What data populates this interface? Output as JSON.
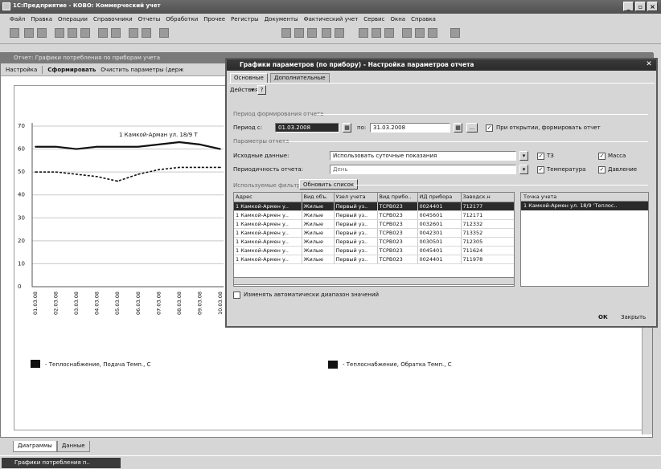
{
  "app": {
    "title": "1С:Предприятие - КОВО: Коммерческий учет",
    "window_controls": [
      "_",
      "▫",
      "×"
    ]
  },
  "menu": [
    "Файл",
    "Правка",
    "Операции",
    "Справочники",
    "Отчеты",
    "Обработки",
    "Прочее",
    "Регистры",
    "Документы",
    "Фактический учет",
    "Сервис",
    "Окна",
    "Справка"
  ],
  "report": {
    "title": "Отчет: Графики потребления по приборам учета",
    "toolbar": {
      "settings": "Настройка",
      "generate": "Сформировать",
      "clear": "Очистить параметры (держ"
    },
    "tabs": [
      "Диаграммы",
      "Данные"
    ]
  },
  "chart_data": {
    "type": "line",
    "ylim": [
      0,
      70
    ],
    "yticks": [
      "70",
      "60",
      "50",
      "40",
      "30",
      "20",
      "10",
      "0"
    ],
    "categories": [
      "01.03.08",
      "02.03.08",
      "03.03.08",
      "04.03.08",
      "05.03.08",
      "06.03.08",
      "07.03.08",
      "08.03.08",
      "09.03.08",
      "10.03.08"
    ],
    "annotation": "1 Камкой-Арман ул. 18/9 Т",
    "series": [
      {
        "name": "- Теплоснабжение, Подача Темп., С",
        "values": [
          61,
          61,
          60,
          61,
          61,
          61,
          62,
          63,
          62,
          60
        ],
        "style": "solid"
      },
      {
        "name": "- Теплоснабжение, Обратка Темп., С",
        "values": [
          50,
          50,
          49,
          48,
          46,
          49,
          51,
          52,
          52,
          52
        ],
        "style": "dashed"
      }
    ]
  },
  "dialog": {
    "title": "Графики параметров (по прибору) - Настройка параметров отчета",
    "tabs": [
      "Основные",
      "Дополнительные"
    ],
    "actions": "Действия",
    "help": "?",
    "period_group": "Период формирования отчета",
    "period_from_label": "Период с:",
    "period_from": "01.03.2008",
    "period_to_label": "по:",
    "period_to": "31.03.2008",
    "period_btn": "...",
    "auto_generate": "При открытии, формировать отчет",
    "params_group": "Параметры отчета",
    "source_label": "Исходные данные:",
    "source_value": "Использовать суточные показания",
    "periodicity_label": "Периодичность отчета:",
    "periodicity_value": "День",
    "filters_label": "Используемые фильтры",
    "refresh_btn": "Обновить список",
    "checks": {
      "t3": "ТЗ",
      "mass": "Масса",
      "temperature": "Температура",
      "pressure": "Давление"
    },
    "grid": {
      "columns": [
        "Адрес",
        "Вид объ.",
        "Узел учета",
        "Вид прибо..",
        "ИД прибора",
        "Заводск.н"
      ],
      "rows": [
        [
          "1 Камкой-Армен у..",
          "Жилые",
          "Первый уз..",
          "ТСРВ023",
          "0024401",
          "712177"
        ],
        [
          "1 Камкой-Армен у..",
          "Жилые",
          "Первый уз..",
          "ТСРВ023",
          "0045601",
          "712171"
        ],
        [
          "1 Камкой-Армен у..",
          "Жилые",
          "Первый уз..",
          "ТСРВ023",
          "0032601",
          "712332"
        ],
        [
          "1 Камкой-Армен у..",
          "Жилые",
          "Первый уз..",
          "ТСРВ023",
          "0042301",
          "713352"
        ],
        [
          "1 Камкой-Армен у..",
          "Жилые",
          "Первый уз..",
          "ТСРВ023",
          "0030501",
          "712305"
        ],
        [
          "1 Камкой-Армен у..",
          "Жилые",
          "Первый уз..",
          "ТСРВ023",
          "0045401",
          "711624"
        ],
        [
          "1 Камкой-Армен у..",
          "Жилые",
          "Первый уз..",
          "ТСРВ023",
          "0024401",
          "711978"
        ]
      ]
    },
    "points_header": "Точка учета",
    "points": [
      "1 Камкой-Армен ул. 18/9 'Теплос.."
    ],
    "auto_range": "Изменять автоматически диапазон значений",
    "ok_btn": "ОК",
    "close_btn": "Закрыть"
  },
  "taskbar": {
    "item": "Графики потребления п.."
  }
}
